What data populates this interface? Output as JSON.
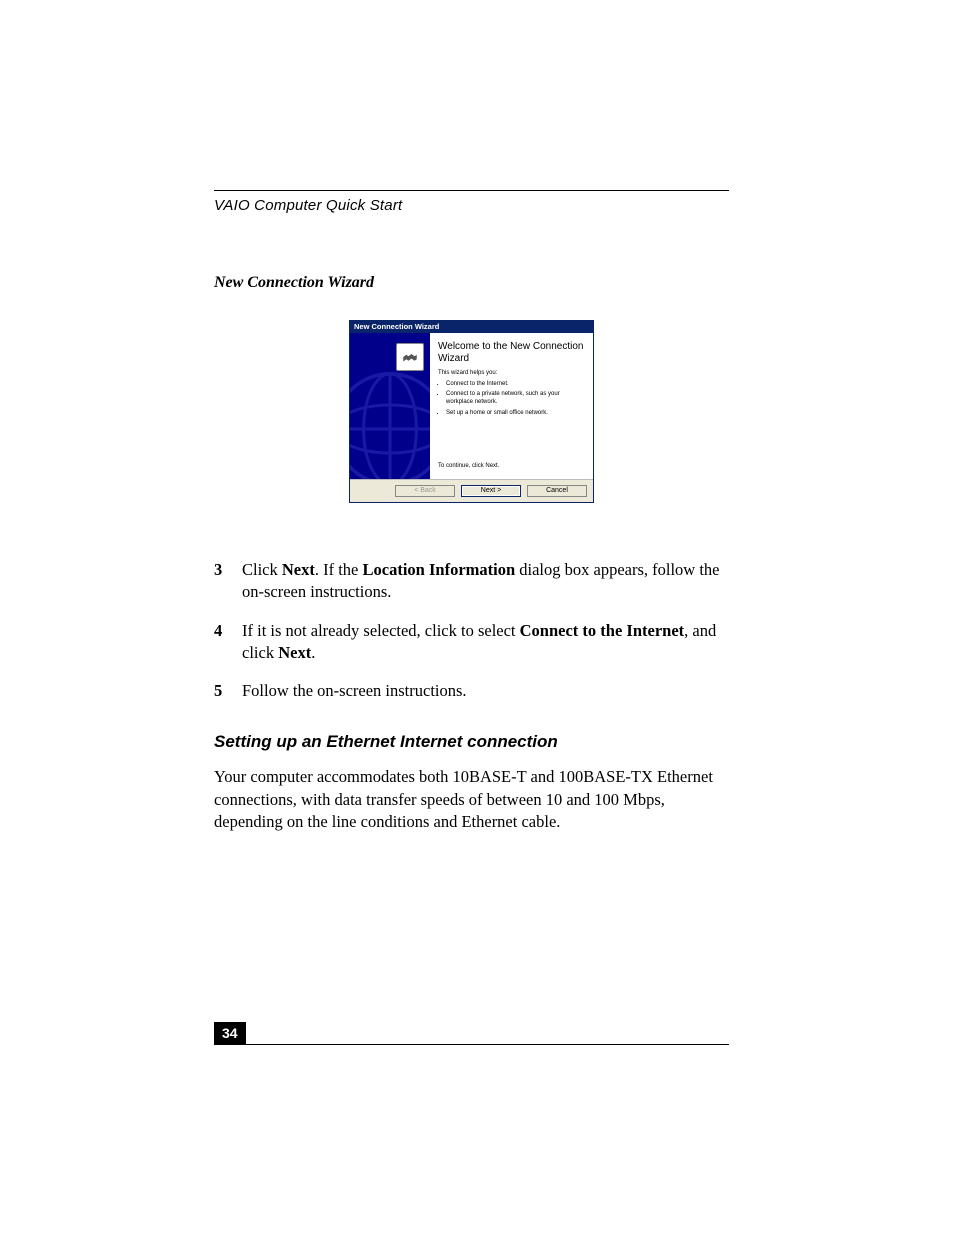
{
  "header": "VAIO Computer Quick Start",
  "caption": "New Connection Wizard",
  "wizard": {
    "title": "New Connection Wizard",
    "heading": "Welcome to the New Connection Wizard",
    "helps": "This wizard helps you:",
    "bullets": [
      "Connect to the Internet.",
      "Connect to a private network, such as your workplace network.",
      "Set up a home or small office network."
    ],
    "continue": "To continue, click Next.",
    "buttons": {
      "back": "< Back",
      "next": "Next >",
      "cancel": "Cancel"
    }
  },
  "steps": [
    {
      "n": "3",
      "pre": "Click ",
      "bold1": "Next",
      "mid": ". If the ",
      "bold2": "Location Information",
      "post": " dialog box appears, follow the on-screen instructions."
    },
    {
      "n": "4",
      "pre": "If it is not already selected, click to select ",
      "bold1": "Connect to the Internet",
      "mid": ", and click ",
      "bold2": "Next",
      "post": "."
    },
    {
      "n": "5",
      "pre": "Follow the on-screen instructions.",
      "bold1": "",
      "mid": "",
      "bold2": "",
      "post": ""
    }
  ],
  "subhead": "Setting up an Ethernet Internet connection",
  "para": "Your computer accommodates both 10BASE-T and 100BASE-TX Ethernet connections, with data transfer speeds of between 10 and 100 Mbps, depending on the line conditions and Ethernet cable.",
  "page_number": "34"
}
